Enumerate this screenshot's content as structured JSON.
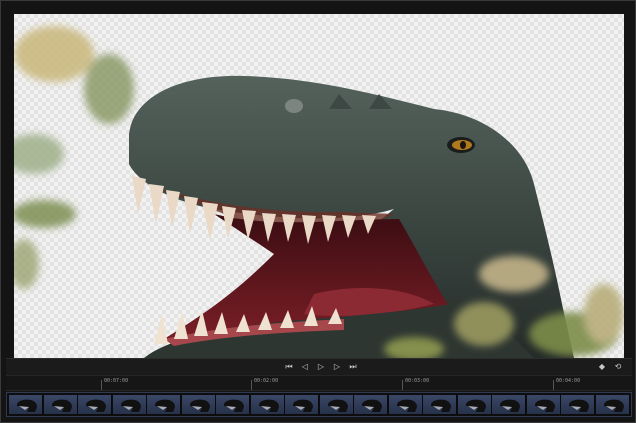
{
  "viewer": {
    "content": "t-rex-head-on-transparent-checkerboard"
  },
  "transport": {
    "buttons": [
      {
        "name": "go-to-start-button",
        "icon": "skip-back-icon",
        "glyph": "⏮"
      },
      {
        "name": "step-back-button",
        "icon": "step-back-icon",
        "glyph": "◁"
      },
      {
        "name": "play-button",
        "icon": "play-icon",
        "glyph": "▷"
      },
      {
        "name": "step-forward-button",
        "icon": "step-forward-icon",
        "glyph": "▷"
      },
      {
        "name": "go-to-end-button",
        "icon": "skip-forward-icon",
        "glyph": "⏭"
      }
    ],
    "right_buttons": [
      {
        "name": "marker-button",
        "icon": "diamond-icon",
        "glyph": "◆"
      },
      {
        "name": "loop-button",
        "icon": "loop-icon",
        "glyph": "⟲"
      }
    ]
  },
  "ruler": {
    "timecodes": [
      "00:07:00",
      "00:02:00",
      "00:03:00",
      "00:04:00"
    ]
  },
  "filmstrip": {
    "thumbnail_count": 18
  },
  "colors": {
    "background": "#141414",
    "filmstrip_accent": "#2f3a52"
  }
}
